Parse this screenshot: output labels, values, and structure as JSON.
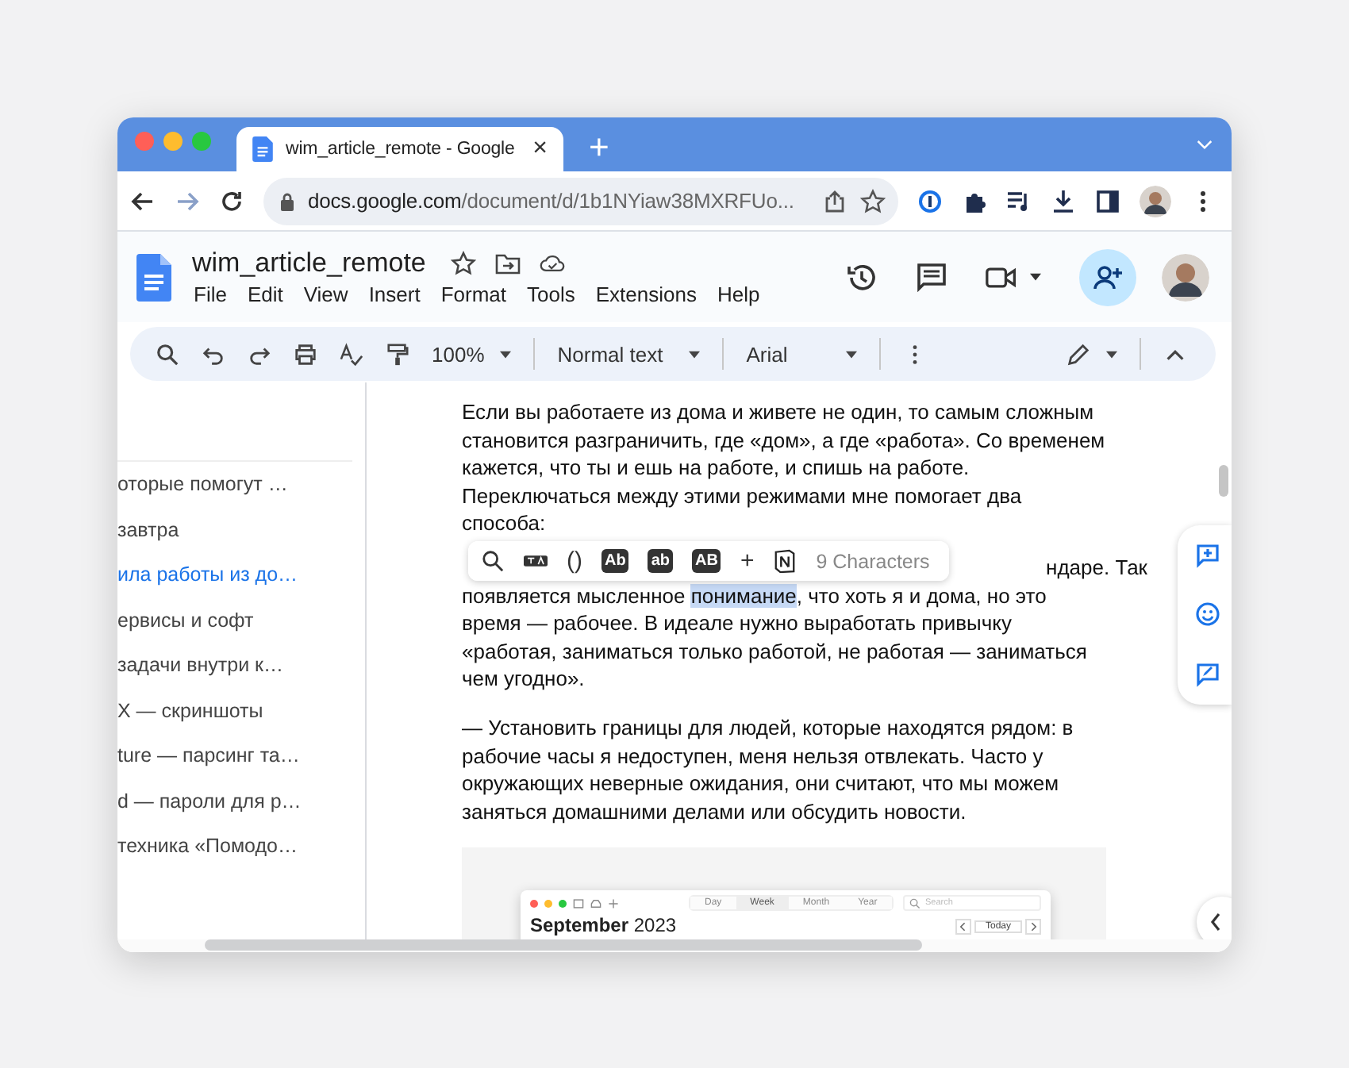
{
  "browser": {
    "tab": {
      "title": "wim_article_remote - Google",
      "close": "×"
    },
    "new_tab": "+",
    "url": {
      "host": "docs.google.com",
      "path": "/document/d/1b1NYiaw38MXRFUo..."
    }
  },
  "doc": {
    "title": "wim_article_remote",
    "menu": [
      "File",
      "Edit",
      "View",
      "Insert",
      "Format",
      "Tools",
      "Extensions",
      "Help"
    ]
  },
  "toolbar": {
    "zoom": "100%",
    "style": "Normal text",
    "font": "Arial"
  },
  "outline": [
    {
      "text": "оторые помогут …",
      "selected": false
    },
    {
      "text": "завтра",
      "selected": false
    },
    {
      "text": "ила работы из до…",
      "selected": true
    },
    {
      "text": "ервисы и софт",
      "selected": false
    },
    {
      "text": "задачи внутри к…",
      "selected": false
    },
    {
      "text": "X — скриншоты",
      "selected": false
    },
    {
      "text": "ture — парсинг та…",
      "selected": false
    },
    {
      "text": "d — пароли для р…",
      "selected": false
    },
    {
      "text": "техника «Помодо…",
      "selected": false
    }
  ],
  "body": {
    "paragraph_1": "Если вы работаете из дома и живете не один, то самым сложным становится разграничить, где «дом», а где «работа». Со временем кажется, что ты и ешь на работе, и спишь на работе. Переключаться между этими режимами мне помогает два способа:",
    "paragraph_2": {
      "visible_tail": "ндаре. Так",
      "before": "появляется мысленное ",
      "selection": "понимание",
      "after": ", что хоть я и дома, но это время — рабочее. В идеале нужно выработать привычку «работая, заниматься только работой, не работая — заниматься чем угодно»."
    },
    "paragraph_3": "— Установить границы для людей, которые находятся рядом: в рабочие часы я недоступен, меня нельзя отвлекать. Часто у окружающих неверные ожидания, они считают, что мы можем заняться домашними делами или обсудить новости."
  },
  "popup": {
    "brackets": "()",
    "cases": [
      "Ab",
      "ab",
      "AB"
    ],
    "add": "+",
    "count": "9 Characters"
  },
  "embedded_calendar": {
    "views": [
      {
        "label": "Day",
        "selected": false
      },
      {
        "label": "Week",
        "selected": true
      },
      {
        "label": "Month",
        "selected": false
      },
      {
        "label": "Year",
        "selected": false
      }
    ],
    "search": {
      "placeholder": "Search"
    },
    "heading": "**September** 2023",
    "today": "Today"
  }
}
